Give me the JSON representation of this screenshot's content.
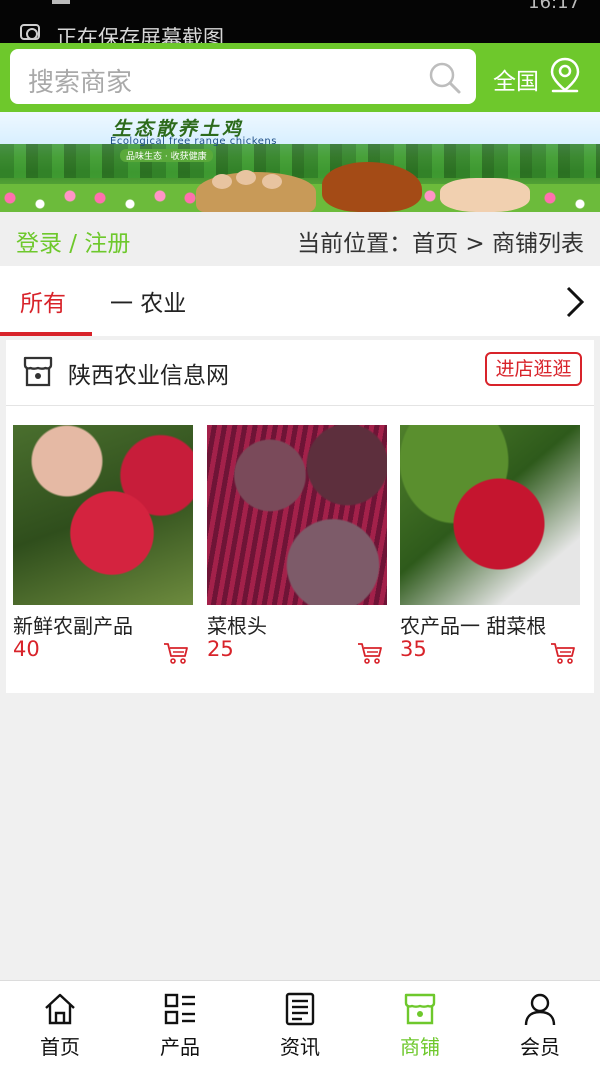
{
  "statusbar": {
    "notice": "正在保存屏幕截图",
    "time": "16:17"
  },
  "search": {
    "placeholder": "搜索商家",
    "region_label": "全国"
  },
  "banner": {
    "title": "生态散养土鸡",
    "subtitle": "Ecological free range chickens",
    "slogan": "品味生态 · 收获健康"
  },
  "crumbbar": {
    "login_register": "登录 / 注册",
    "location": "当前位置：首页 > 商铺列表"
  },
  "categories": {
    "tabs": [
      {
        "label": "所有",
        "active": true
      },
      {
        "label": "一 农业",
        "active": false
      }
    ]
  },
  "shop": {
    "name": "陕西农业信息网",
    "visit_label": "进店逛逛",
    "products": [
      {
        "name": "新鲜农副产品",
        "price": "40"
      },
      {
        "name": "菜根头",
        "price": "25"
      },
      {
        "name": "农产品一 甜菜根",
        "price": "35"
      }
    ]
  },
  "bottom_nav": {
    "items": [
      {
        "label": "首页",
        "icon": "home-icon"
      },
      {
        "label": "产品",
        "icon": "grid-icon"
      },
      {
        "label": "资讯",
        "icon": "news-icon"
      },
      {
        "label": "商铺",
        "icon": "store-icon",
        "active": true
      },
      {
        "label": "会员",
        "icon": "user-icon"
      }
    ]
  },
  "colors": {
    "brand_green": "#6ec82c",
    "accent_red": "#d8232a"
  }
}
